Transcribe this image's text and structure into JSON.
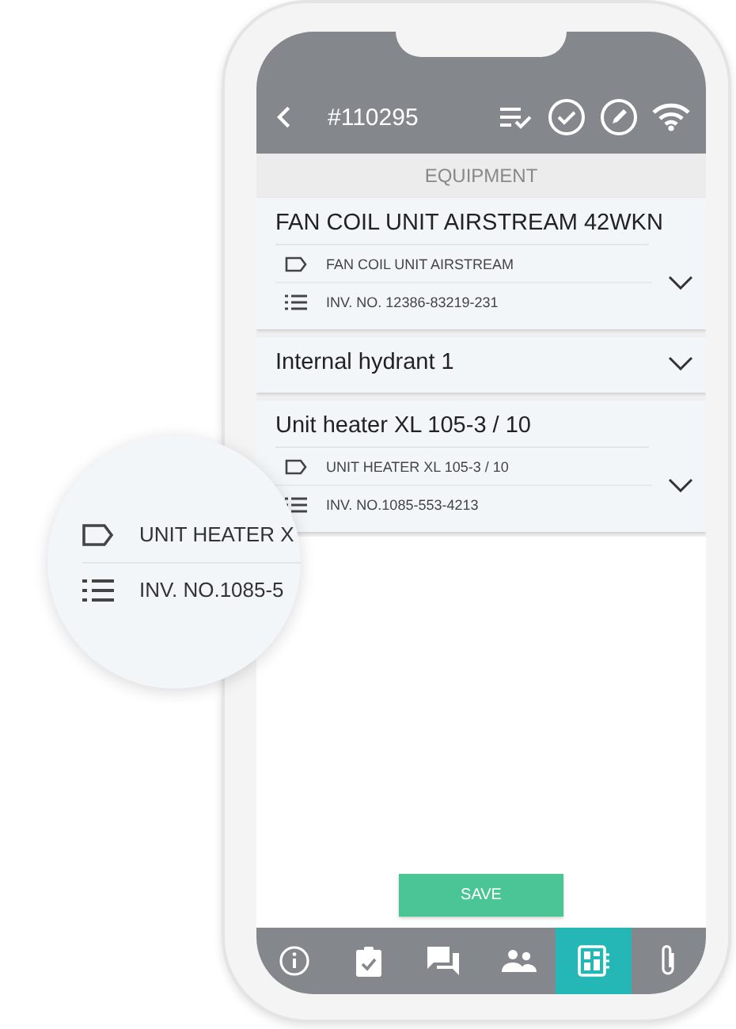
{
  "header": {
    "title": "#110295"
  },
  "section": "EQUIPMENT",
  "items": [
    {
      "title": "FAN COIL UNIT AIRSTREAM 42WKN",
      "expanded": true,
      "details": [
        {
          "kind": "tag",
          "text": "FAN COIL UNIT AIRSTREAM"
        },
        {
          "kind": "list",
          "text": "INV. NO. 12386-83219-231"
        }
      ]
    },
    {
      "title": "Internal hydrant 1",
      "expanded": false
    },
    {
      "title": "Unit heater XL 105-3 / 10",
      "expanded": true,
      "details": [
        {
          "kind": "tag",
          "text": "UNIT HEATER XL 105-3 / 10"
        },
        {
          "kind": "list",
          "text": "INV. NO.1085-553-4213"
        }
      ]
    }
  ],
  "magnifier": [
    {
      "kind": "tag",
      "text": "UNIT HEATER X"
    },
    {
      "kind": "list",
      "text": "INV. NO.1085-5"
    }
  ],
  "save_button": "SAVE",
  "nav": [
    {
      "kind": "info",
      "selected": false
    },
    {
      "kind": "tasks",
      "selected": false
    },
    {
      "kind": "chat",
      "selected": false
    },
    {
      "kind": "people",
      "selected": false
    },
    {
      "kind": "equipment",
      "selected": true
    },
    {
      "kind": "attachment",
      "selected": false
    }
  ]
}
